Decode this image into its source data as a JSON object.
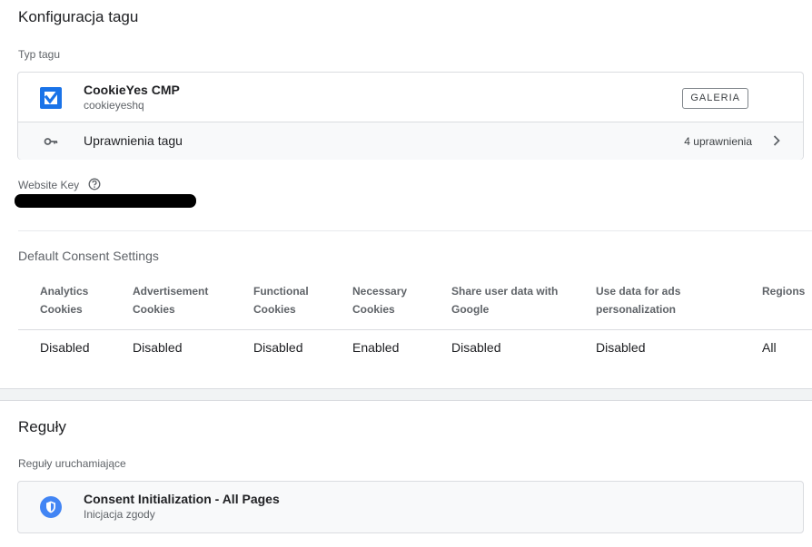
{
  "config": {
    "title": "Konfiguracja tagu",
    "tag_type_label": "Typ tagu",
    "tag": {
      "name": "CookieYes CMP",
      "vendor": "cookieyeshq",
      "gallery_label": "GALERIA"
    },
    "permissions": {
      "label": "Uprawnienia tagu",
      "count": "4 uprawnienia"
    },
    "website_key_label": "Website Key",
    "default_consent_title": "Default Consent Settings",
    "consent_table": {
      "headers": [
        [
          "Analytics",
          "Cookies"
        ],
        [
          "Advertisement",
          "Cookies"
        ],
        [
          "Functional",
          "Cookies"
        ],
        [
          "Necessary",
          "Cookies"
        ],
        [
          "Share user data with",
          "Google"
        ],
        [
          "Use data for ads",
          "personalization"
        ],
        [
          "Regions",
          ""
        ]
      ],
      "row": [
        "Disabled",
        "Disabled",
        "Disabled",
        "Enabled",
        "Disabled",
        "Disabled",
        "All"
      ]
    }
  },
  "rules": {
    "title": "Reguły",
    "firing_label": "Reguły uruchamiające",
    "trigger": {
      "name": "Consent Initialization - All Pages",
      "type": "Inicjacja zgody"
    }
  },
  "colors": {
    "accent": "#1a73e8",
    "text": "#202124",
    "muted": "#5f6368",
    "border": "#dadce0"
  },
  "icons": {
    "tag_logo": "cookieyes-checkbox-icon",
    "permissions": "key-icon",
    "permissions_nav": "chevron-right-icon",
    "help": "help-circle-icon",
    "trigger": "shield-icon"
  }
}
